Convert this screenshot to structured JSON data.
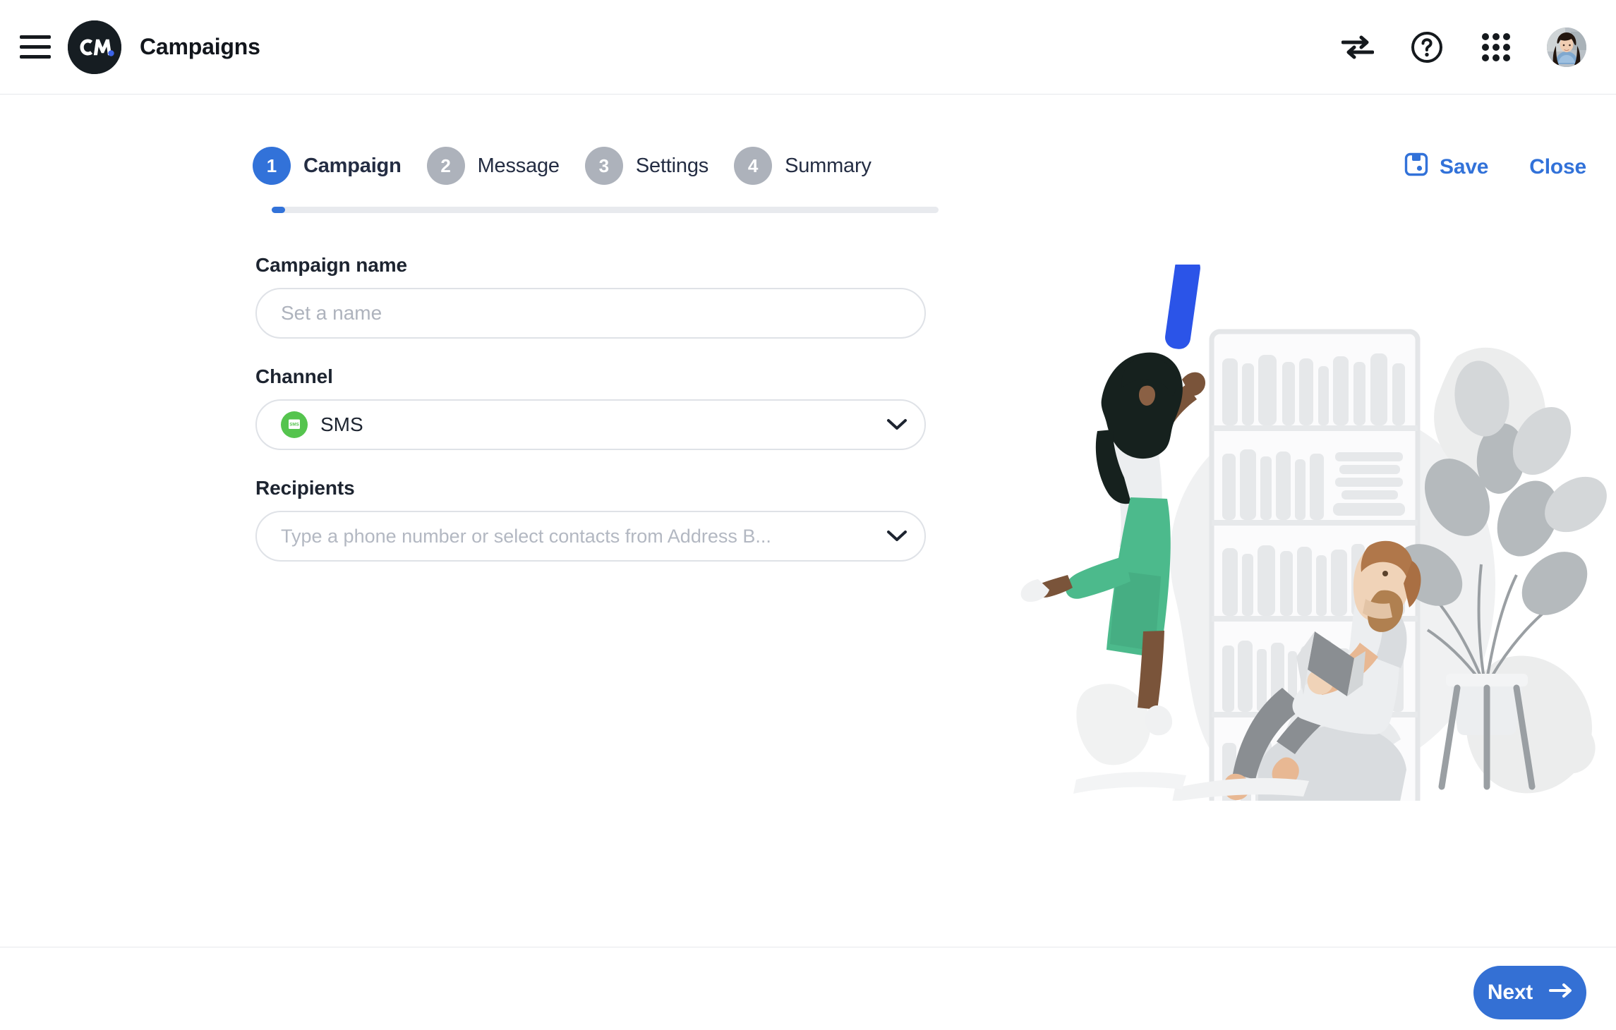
{
  "header": {
    "title": "Campaigns",
    "menu_icon": "hamburger-menu-icon",
    "logo_alt": "CM.com logo",
    "icons": [
      {
        "name": "switch-arrows-icon",
        "label": "Switch account"
      },
      {
        "name": "help-question-icon",
        "label": "Help"
      },
      {
        "name": "apps-grid-icon",
        "label": "Apps"
      }
    ],
    "avatar_name": "user-avatar"
  },
  "wizard": {
    "steps": [
      {
        "number": "1",
        "label": "Campaign",
        "state": "active"
      },
      {
        "number": "2",
        "label": "Message",
        "state": "inactive"
      },
      {
        "number": "3",
        "label": "Settings",
        "state": "inactive"
      },
      {
        "number": "4",
        "label": "Summary",
        "state": "inactive"
      }
    ],
    "progress_percent": 2
  },
  "toolbar": {
    "save_label": "Save",
    "close_label": "Close",
    "save_icon": "floppy-disk-save-icon"
  },
  "form": {
    "campaign_name": {
      "label": "Campaign name",
      "placeholder": "Set a name",
      "value": ""
    },
    "channel": {
      "label": "Channel",
      "value": "SMS",
      "icon": "sms-channel-icon",
      "chevron": "chevron-down-icon"
    },
    "recipients": {
      "label": "Recipients",
      "placeholder": "Type a phone number or select contacts from Address B...",
      "value": "",
      "chevron": "chevron-down-icon"
    }
  },
  "footer": {
    "next_label": "Next",
    "next_icon": "arrow-right-icon"
  },
  "illustration": {
    "name": "bookshelf-people-illustration"
  },
  "colors": {
    "accent_blue": "#3272d9",
    "button_blue": "#3470d4",
    "sms_green": "#55c44e",
    "step_inactive_gray": "#adb2bb",
    "text_dark": "#1d2430",
    "placeholder_gray": "#b3b8c2",
    "divider": "#e6e8ec"
  }
}
